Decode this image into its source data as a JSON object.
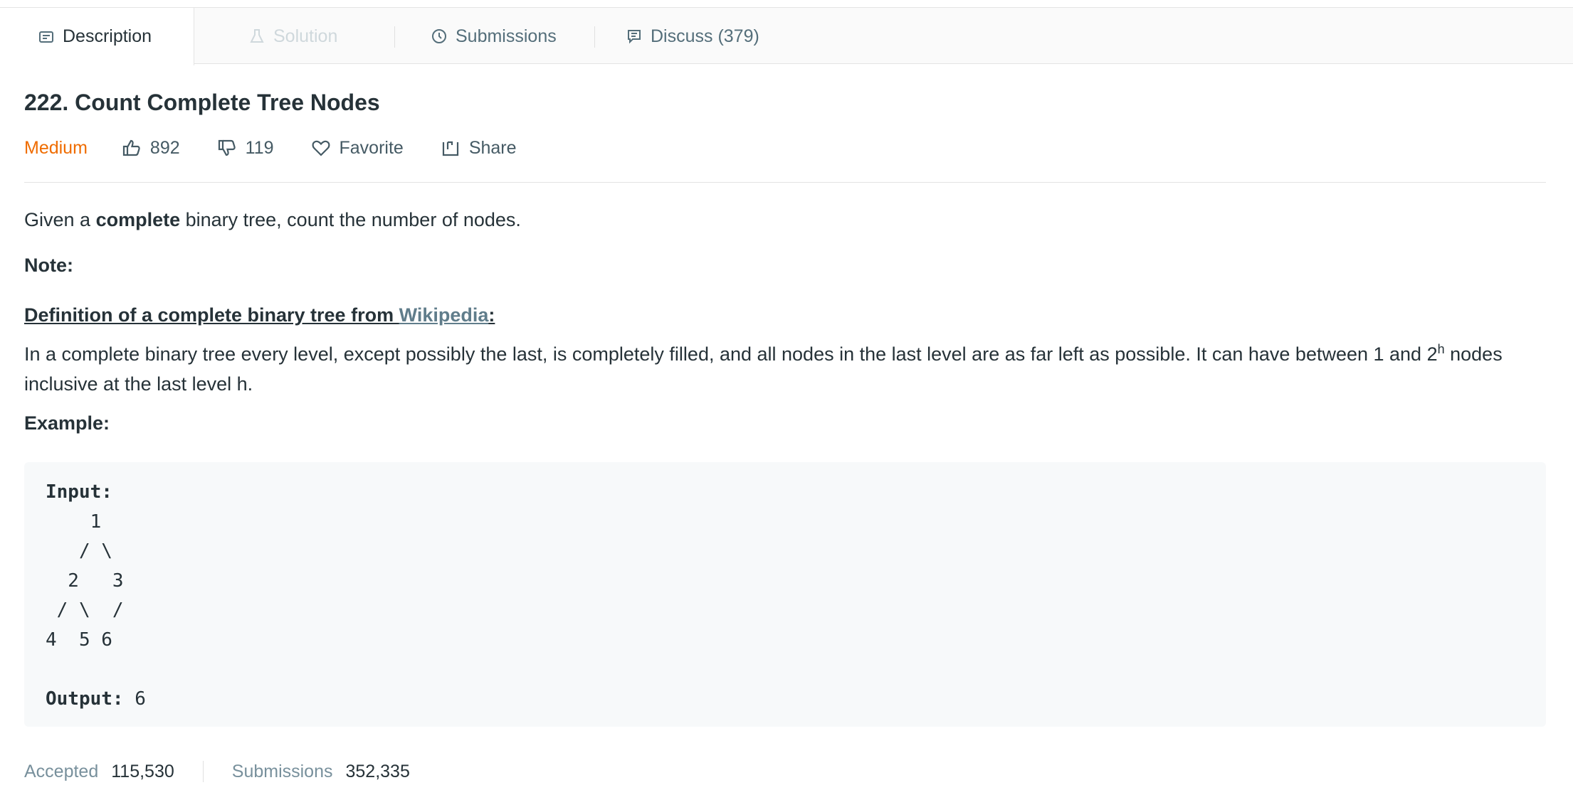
{
  "tabs": [
    {
      "label": "Description",
      "icon": "description-icon",
      "state": "active"
    },
    {
      "label": "Solution",
      "icon": "flask-icon",
      "state": "disabled"
    },
    {
      "label": "Submissions",
      "icon": "clock-icon",
      "state": "normal"
    },
    {
      "label": "Discuss (379)",
      "icon": "discuss-icon",
      "state": "normal"
    }
  ],
  "problem": {
    "title": "222. Count Complete Tree Nodes",
    "difficulty": "Medium",
    "likes": "892",
    "dislikes": "119",
    "favorite_label": "Favorite",
    "share_label": "Share"
  },
  "description": {
    "intro_prefix": "Given a ",
    "intro_bold": "complete",
    "intro_suffix": " binary tree, count the number of nodes.",
    "note_label": "Note:",
    "def_heading": "Definition of a complete binary tree from ",
    "def_link": "Wikipedia",
    "def_heading_end": ":",
    "def_text_1": "In a complete binary tree every level, except possibly the last, is completely filled, and all nodes in the last level are as far left as possible. It can have between 1 and 2",
    "def_sup": "h",
    "def_text_2": " nodes inclusive at the last level h.",
    "example_label": "Example:"
  },
  "example": {
    "input_label": "Input:",
    "tree_lines": [
      "    1",
      "   / \\",
      "  2   3",
      " / \\  /",
      "4  5 6"
    ],
    "output_label": "Output:",
    "output_value": " 6"
  },
  "stats": {
    "accepted_label": "Accepted",
    "accepted_value": "115,530",
    "submissions_label": "Submissions",
    "submissions_value": "352,335"
  },
  "colors": {
    "medium": "#ef6c00",
    "link": "#607d8b"
  }
}
